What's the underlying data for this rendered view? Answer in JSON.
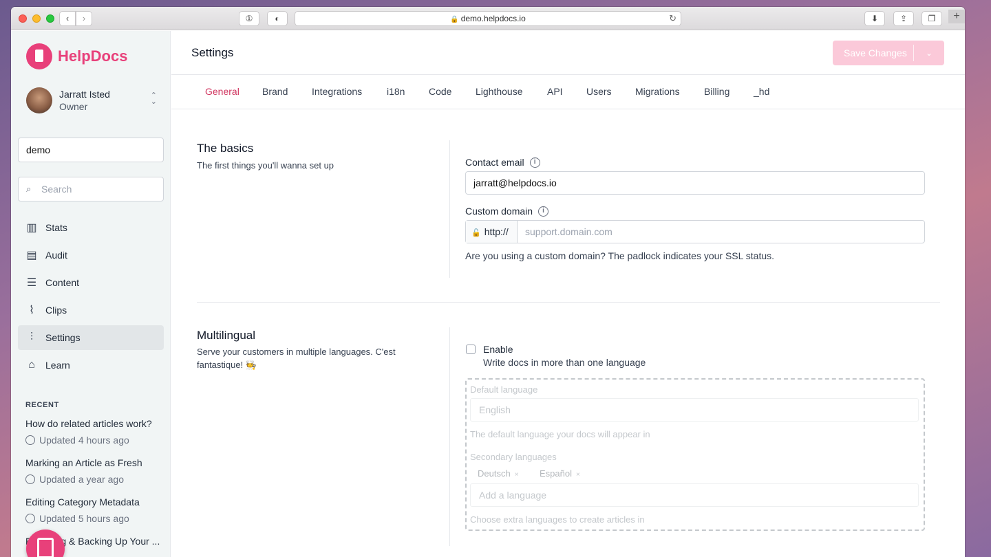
{
  "browser": {
    "url": "demo.helpdocs.io",
    "back_glyph": "‹",
    "forward_glyph": "›",
    "reload_glyph": "↻",
    "newtab_glyph": "+",
    "onepassword_glyph": "①",
    "shield_glyph": "◐",
    "download_glyph": "⬇",
    "share_glyph": "⇪",
    "tabs_glyph": "❐"
  },
  "brand": {
    "name": "HelpDocs",
    "color": "#e8407a"
  },
  "user": {
    "name": "Jarratt Isted",
    "role": "Owner",
    "chevron": "⌃⌄"
  },
  "project": {
    "value": "demo"
  },
  "search": {
    "placeholder": "Search",
    "icon": "search-icon"
  },
  "nav": [
    {
      "label": "Stats",
      "icon": "bar-chart-icon",
      "glyph": "▥"
    },
    {
      "label": "Audit",
      "icon": "clipboard-icon",
      "glyph": "▤"
    },
    {
      "label": "Content",
      "icon": "stack-icon",
      "glyph": "☰"
    },
    {
      "label": "Clips",
      "icon": "paperclip-icon",
      "glyph": "⌇"
    },
    {
      "label": "Settings",
      "icon": "sliders-icon",
      "glyph": "⫶"
    },
    {
      "label": "Learn",
      "icon": "graduation-cap-icon",
      "glyph": "⌂"
    }
  ],
  "recent": {
    "title": "RECENT",
    "items": [
      {
        "name": "How do related articles work?",
        "meta": "Updated 4 hours ago"
      },
      {
        "name": "Marking an Article as Fresh",
        "meta": "Updated a year ago"
      },
      {
        "name": "Editing Category Metadata",
        "meta": "Updated 5 hours ago"
      },
      {
        "name": "Exporting & Backing Up Your ...",
        "meta": ""
      }
    ]
  },
  "header": {
    "title": "Settings",
    "save_label": "Save Changes",
    "save_caret": "⌄",
    "accent": "#d0345e"
  },
  "tabs": [
    "General",
    "Brand",
    "Integrations",
    "i18n",
    "Code",
    "Lighthouse",
    "API",
    "Users",
    "Migrations",
    "Billing",
    "_hd"
  ],
  "basics": {
    "title": "The basics",
    "desc": "The first things you'll wanna set up",
    "contact_label": "Contact email",
    "contact_value": "jarratt@helpdocs.io",
    "domain_label": "Custom domain",
    "domain_prefix": "http://",
    "domain_placeholder": "support.domain.com",
    "domain_help": "Are you using a custom domain? The padlock indicates your SSL status.",
    "info_glyph": "i",
    "lock_glyph": "🔓"
  },
  "multilingual": {
    "title": "Multilingual",
    "desc": "Serve your customers in multiple languages. C'est fantastique! 🧑‍🍳",
    "enable_label": "Enable",
    "enable_desc": "Write docs in more than one language",
    "default_label": "Default language",
    "default_value": "English",
    "default_help": "The default language your docs will appear in",
    "secondary_label": "Secondary languages",
    "chips": [
      "Deutsch",
      "Español"
    ],
    "chip_x": "×",
    "add_placeholder": "Add a language",
    "secondary_help": "Choose extra languages to create articles in"
  }
}
